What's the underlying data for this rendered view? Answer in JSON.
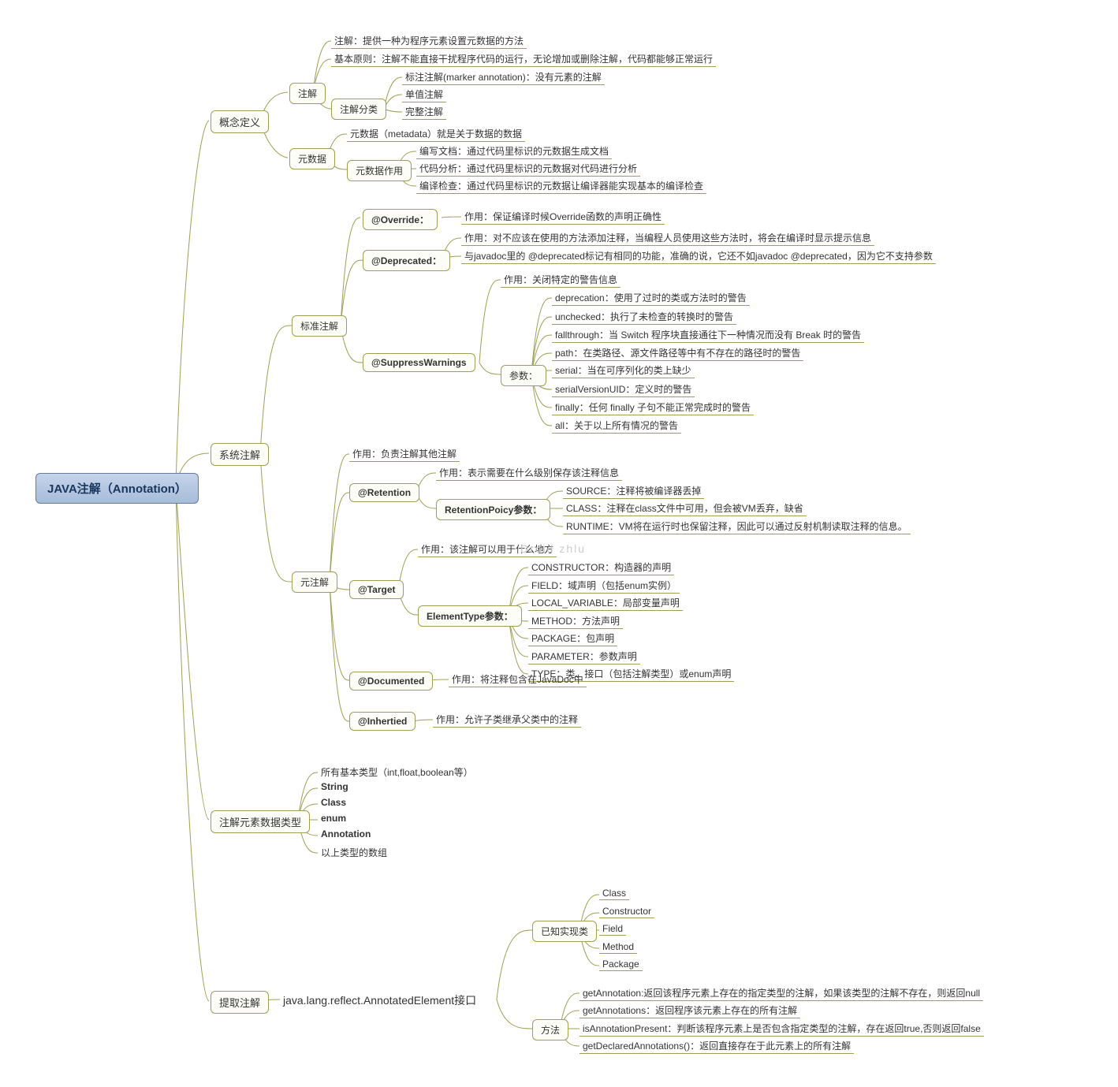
{
  "root": "JAVA注解（Annotation）",
  "n": {
    "concept": "概念定义",
    "annot": "注解",
    "annot_def": "注解：提供一种为程序元素设置元数据的方法",
    "annot_principle": "基本原则：注解不能直接干扰程序代码的运行，无论增加或删除注解，代码都能够正常运行",
    "annot_cat": "注解分类",
    "annot_marker": "标注注解(marker annotation)：没有元素的注解",
    "annot_single": "单值注解",
    "annot_full": "完整注解",
    "metadata": "元数据",
    "metadata_def": "元数据（metadata）就是关于数据的数据",
    "metadata_use": "元数据作用",
    "meta_doc": "编写文档：通过代码里标识的元数据生成文档",
    "meta_analysis": "代码分析：通过代码里标识的元数据对代码进行分析",
    "meta_check": "编译检查：通过代码里标识的元数据让编译器能实现基本的编译检查",
    "sys": "系统注解",
    "std": "标准注解",
    "override": "@Override：",
    "override_use": "作用：保证编译时候Override函数的声明正确性",
    "deprecated": "@Deprecated：",
    "dep_use": "作用：对不应该在使用的方法添加注释，当编程人员使用这些方法时，将会在编译时显示提示信息",
    "dep_javadoc": "与javadoc里的 @deprecated标记有相同的功能，准确的说，它还不如javadoc @deprecated，因为它不支持参数",
    "sw": "@SuppressWarnings",
    "sw_use": "作用：关闭特定的警告信息",
    "sw_params": "参数：",
    "sw_dep": "deprecation：使用了过时的类或方法时的警告",
    "sw_unchecked": "unchecked：执行了未检查的转换时的警告",
    "sw_fall": "fallthrough：当 Switch 程序块直接通往下一种情况而没有 Break 时的警告",
    "sw_path": "path：在类路径、源文件路径等中有不存在的路径时的警告",
    "sw_serial": "serial：当在可序列化的类上缺少",
    "sw_uid": "serialVersionUID：定义时的警告",
    "sw_finally": "finally：任何 finally 子句不能正常完成时的警告",
    "sw_all": "all：关于以上所有情况的警告",
    "meta_annot": "元注解",
    "meta_use": "作用：负责注解其他注解",
    "retention": "@Retention",
    "ret_use": "作用：表示需要在什么级别保存该注释信息",
    "ret_params": "RetentionPoicy参数：",
    "ret_source": "SOURCE：注释将被编译器丢掉",
    "ret_class": "CLASS：注释在class文件中可用，但会被VM丢弃，缺省",
    "ret_runtime": "RUNTIME：VM将在运行时也保留注释，因此可以通过反射机制读取注释的信息。",
    "target": "@Target",
    "target_use": "作用：该注解可以用于什么地方",
    "target_params": "ElementType参数：",
    "et_constructor": "CONSTRUCTOR：构造器的声明",
    "et_field": "FIELD：域声明（包括enum实例）",
    "et_local": "LOCAL_VARIABLE：局部变量声明",
    "et_method": "METHOD：方法声明",
    "et_package": "PACKAGE：包声明",
    "et_param": "PARAMETER：参数声明",
    "et_type": "TYPE：类、接口（包括注解类型）或enum声明",
    "documented": "@Documented",
    "doc_use": "作用：将注释包含在JavaDoc中",
    "inherited": "@Inhertied",
    "inh_use": "作用：允许子类继承父类中的注释",
    "datatypes": "注解元素数据类型",
    "dt_prim": "所有基本类型（int,float,boolean等）",
    "dt_string": "String",
    "dt_class": "Class",
    "dt_enum": "enum",
    "dt_annot": "Annotation",
    "dt_array": "以上类型的数组",
    "extract": "提取注解",
    "ae": "java.lang.reflect.AnnotatedElement接口",
    "known": "已知实现类",
    "k_class": "Class",
    "k_constructor": "Constructor",
    "k_field": "Field",
    "k_method": "Method",
    "k_package": "Package",
    "methods": "方法",
    "m_get": "getAnnotation:返回该程序元素上存在的指定类型的注解，如果该类型的注解不存在，则返回null",
    "m_gets": "getAnnotations：返回程序该元素上存在的所有注解",
    "m_present": "isAnnotationPresent：判断该程序元素上是否包含指定类型的注解，存在返回true,否则返回false",
    "m_declared": "getDeclaredAnnotations()：返回直接存在于此元素上的所有注解"
  },
  "watermark": "Droid zhlu"
}
